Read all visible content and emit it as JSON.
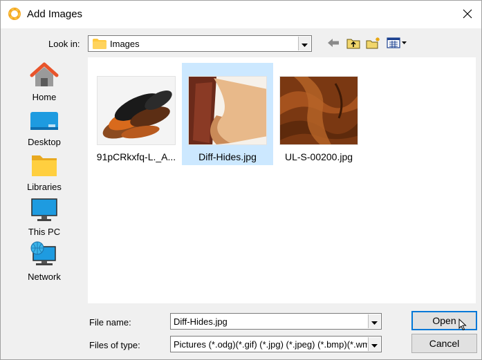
{
  "window": {
    "title": "Add Images",
    "icon": "app-ring-icon",
    "close_icon": "close-icon"
  },
  "look_in": {
    "label": "Look in:",
    "value": "Images"
  },
  "toolbar": {
    "icons": [
      "back-arrow-icon",
      "up-folder-icon",
      "new-folder-icon",
      "view-menu-icon"
    ]
  },
  "places": [
    {
      "label": "Home",
      "icon": "home-icon"
    },
    {
      "label": "Desktop",
      "icon": "desktop-icon"
    },
    {
      "label": "Libraries",
      "icon": "libraries-icon"
    },
    {
      "label": "This PC",
      "icon": "this-pc-icon"
    },
    {
      "label": "Network",
      "icon": "network-icon"
    }
  ],
  "files": [
    {
      "name": "91pCRkxfq-L._A...",
      "selected": false
    },
    {
      "name": "Diff-Hides.jpg",
      "selected": true
    },
    {
      "name": "UL-S-00200.jpg",
      "selected": false
    }
  ],
  "file_name": {
    "label": "File name:",
    "value": "Diff-Hides.jpg"
  },
  "file_type": {
    "label": "Files of type:",
    "value": "Pictures (*.odg)(*.gif) (*.jpg) (*.jpeg) (*.bmp)(*.wm"
  },
  "buttons": {
    "open": "Open",
    "cancel": "Cancel"
  },
  "colors": {
    "selection": "#cce8ff",
    "accent": "#0078d7",
    "folder": "#ffc83d"
  }
}
